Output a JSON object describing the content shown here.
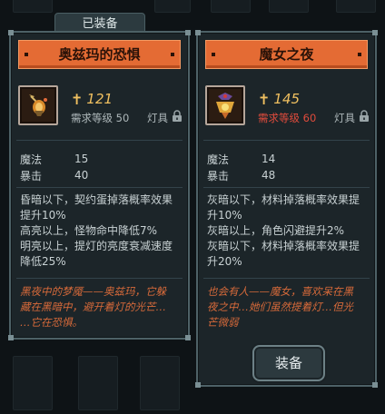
{
  "equipped_tab": "已装备",
  "left_card": {
    "title": "奥兹玛的恐惧",
    "price": "121",
    "requirement": "需求等级 50",
    "slot_type": "灯具",
    "stats": [
      {
        "name": "魔法",
        "value": "15"
      },
      {
        "name": "暴击",
        "value": "40"
      }
    ],
    "effects": [
      "昏暗以下，契约蛋掉落概率效果",
      "提升10%",
      "高亮以上，怪物命中降低7%",
      "明亮以上，提灯的亮度衰减速度",
      "降低25%"
    ],
    "lore": [
      "黑夜中的梦魇——奥兹玛，它躲",
      "藏在黑暗中，避开着灯的光芒…",
      "…它在恐惧。"
    ]
  },
  "right_card": {
    "title": "魔女之夜",
    "price": "145",
    "requirement": "需求等级 60",
    "slot_type": "灯具",
    "stats": [
      {
        "name": "魔法",
        "value": "14"
      },
      {
        "name": "暴击",
        "value": "48"
      }
    ],
    "effects": [
      "灰暗以下，材料掉落概率效果提",
      "升10%",
      "灰暗以上，角色闪避提升2%",
      "灰暗以下，材料掉落概率效果提",
      "升20%"
    ],
    "lore": [
      "也会有人——魔女，喜欢呆在黑",
      "夜之中…她们虽然提着灯…但光",
      "芒微弱"
    ],
    "equip_button": "装备"
  },
  "colors": {
    "title_bar": "#e46b34",
    "price": "#f0c060",
    "requirement_unmet": "#e04b3c",
    "lore": "#d76a3a"
  }
}
